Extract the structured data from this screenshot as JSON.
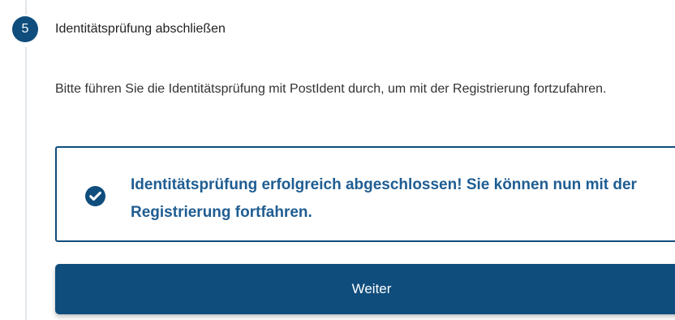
{
  "step": {
    "number": "5",
    "title": "Identitätsprüfung abschließen"
  },
  "content": {
    "instruction": "Bitte führen Sie die Identitätsprüfung mit PostIdent durch, um mit der Registrierung fortzufahren.",
    "success": {
      "icon": "check-circle-icon",
      "message": "Identitätsprüfung erfolgreich abgeschlossen! Sie können nun mit der Registrierung fortfahren."
    }
  },
  "actions": {
    "continue_label": "Weiter"
  },
  "colors": {
    "primary": "#0F4D7D",
    "success_text": "#1F5D92",
    "connector": "#E3E6EA"
  }
}
